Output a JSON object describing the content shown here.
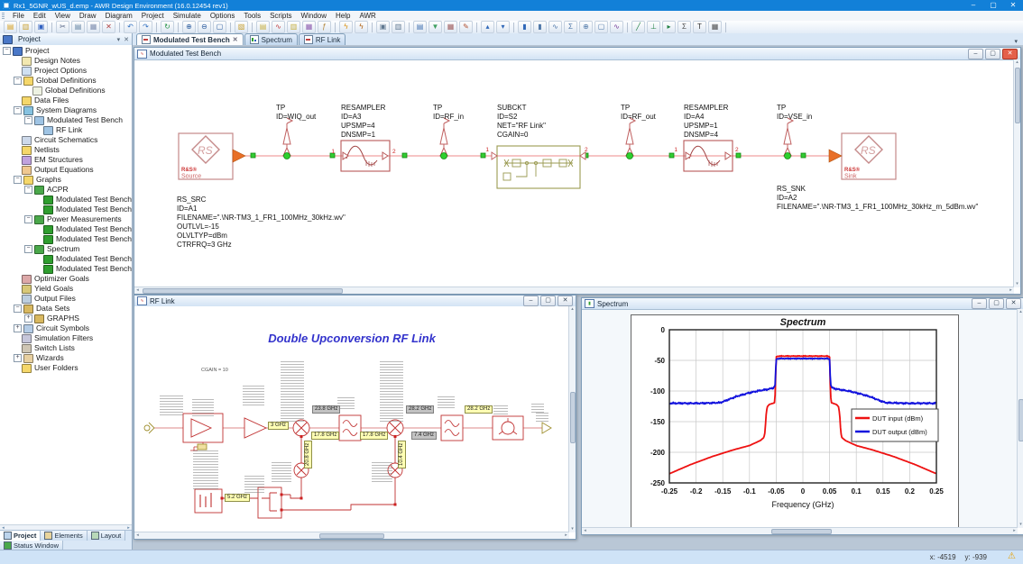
{
  "window": {
    "title": "Rx1_5GNR_wUS_d.emp - AWR Design Environment (16.0.12454 rev1)",
    "controls": {
      "minimize": "–",
      "maximize": "▢",
      "close": "✕"
    }
  },
  "menu": {
    "items": [
      "File",
      "Edit",
      "View",
      "Draw",
      "Diagram",
      "Project",
      "Simulate",
      "Options",
      "Tools",
      "Scripts",
      "Window",
      "Help",
      "AWR"
    ]
  },
  "toolbar": {
    "icons": [
      "new",
      "open",
      "save",
      "sep",
      "cut",
      "copy",
      "paste",
      "delete",
      "sep",
      "undo",
      "redo",
      "sep",
      "refresh",
      "sep",
      "zoom-in",
      "zoom-out",
      "zoom-fit",
      "sep",
      "new-folder",
      "sep",
      "add-schematic",
      "add-system-diagram",
      "add-netlist",
      "add-em-structure",
      "add-output-equation",
      "sep",
      "simulate-analyze",
      "tune",
      "sep",
      "options-dialog",
      "window-split",
      "sep",
      "browser-project",
      "browser-elements",
      "browser-layout",
      "annotate",
      "sep",
      "move-up",
      "move-down",
      "sep",
      "meas-acpr",
      "meas-pwr",
      "meas-spec",
      "meas-sub",
      "meas-mix",
      "meas-q",
      "meas-phase",
      "sep",
      "wire-tool",
      "ground-tool",
      "port-tool",
      "equation-tool",
      "text-tool",
      "block-tool",
      "sep"
    ]
  },
  "project_panel": {
    "title": "Project",
    "tree": [
      {
        "label": "Project",
        "indent": 0,
        "icon": "project",
        "expand": "minus"
      },
      {
        "label": "Design Notes",
        "indent": 1,
        "icon": "notes"
      },
      {
        "label": "Project Options",
        "indent": 1,
        "icon": "options"
      },
      {
        "label": "Global Definitions",
        "indent": 1,
        "icon": "folder",
        "expand": "minus"
      },
      {
        "label": "Global Definitions",
        "indent": 2,
        "icon": "doc"
      },
      {
        "label": "Data Files",
        "indent": 1,
        "icon": "folder"
      },
      {
        "label": "System Diagrams",
        "indent": 1,
        "icon": "system",
        "expand": "minus"
      },
      {
        "label": "Modulated Test Bench",
        "indent": 2,
        "icon": "diagram",
        "expand": "minus"
      },
      {
        "label": "RF Link",
        "indent": 3,
        "icon": "diagram"
      },
      {
        "label": "Circuit Schematics",
        "indent": 1,
        "icon": "schematic"
      },
      {
        "label": "Netlists",
        "indent": 1,
        "icon": "folder"
      },
      {
        "label": "EM Structures",
        "indent": 1,
        "icon": "em"
      },
      {
        "label": "Output Equations",
        "indent": 1,
        "icon": "equations"
      },
      {
        "label": "Graphs",
        "indent": 1,
        "icon": "folder",
        "expand": "minus"
      },
      {
        "label": "ACPR",
        "indent": 2,
        "icon": "graph",
        "expand": "minus"
      },
      {
        "label": "Modulated Test Bench.DB(ACPR(TP.RF_",
        "indent": 3,
        "icon": "meas"
      },
      {
        "label": "Modulated Test Bench.DB(ACPR(TP.RF_",
        "indent": 3,
        "icon": "meas"
      },
      {
        "label": "Power Measurements",
        "indent": 2,
        "icon": "graph",
        "expand": "minus"
      },
      {
        "label": "Modulated Test Bench.DB(PWR_MTR(T",
        "indent": 3,
        "icon": "meas"
      },
      {
        "label": "Modulated Test Bench.DB(PWR_MTR(T",
        "indent": 3,
        "icon": "meas"
      },
      {
        "label": "Spectrum",
        "indent": 2,
        "icon": "graph2",
        "expand": "minus"
      },
      {
        "label": "Modulated Test Bench.DB(PWR_SPEC(T",
        "indent": 3,
        "icon": "meas"
      },
      {
        "label": "Modulated Test Bench.DB(PWR_SPEC(T",
        "indent": 3,
        "icon": "meas"
      },
      {
        "label": "Optimizer Goals",
        "indent": 1,
        "icon": "optimizer"
      },
      {
        "label": "Yield Goals",
        "indent": 1,
        "icon": "yield"
      },
      {
        "label": "Output Files",
        "indent": 1,
        "icon": "output"
      },
      {
        "label": "Data Sets",
        "indent": 1,
        "icon": "datasets",
        "expand": "minus"
      },
      {
        "label": "GRAPHS",
        "indent": 2,
        "icon": "datasets",
        "expand": "plus"
      },
      {
        "label": "Circuit Symbols",
        "indent": 1,
        "icon": "symbols",
        "expand": "plus"
      },
      {
        "label": "Simulation Filters",
        "indent": 1,
        "icon": "filters"
      },
      {
        "label": "Switch Lists",
        "indent": 1,
        "icon": "switch"
      },
      {
        "label": "Wizards",
        "indent": 1,
        "icon": "wizards",
        "expand": "plus"
      },
      {
        "label": "User Folders",
        "indent": 1,
        "icon": "folder"
      }
    ],
    "bottom_tabs": [
      "Project",
      "Elements",
      "Layout"
    ],
    "status_tab": "Status Window"
  },
  "doc_tabs": {
    "tabs": [
      {
        "label": "Modulated Test Bench",
        "active": true
      },
      {
        "label": "Spectrum",
        "active": false
      },
      {
        "label": "RF Link",
        "active": false
      }
    ]
  },
  "mtb": {
    "window_title": "Modulated Test Bench",
    "logo": "RS",
    "source_brand": "R&S®",
    "source_label": "Source",
    "sink_brand": "R&S®",
    "sink_label": "Sink",
    "port1": "1",
    "port2": "2",
    "tp_labels": [
      [
        "TP",
        "ID=WIQ_out"
      ],
      [
        "TP",
        "ID=RF_in"
      ],
      [
        "TP",
        "ID=RF_out"
      ],
      [
        "TP",
        "ID=VSE_in"
      ]
    ],
    "resampler1": [
      "RESAMPLER",
      "ID=A3",
      "UPSMP=4",
      "DNSMP=1"
    ],
    "subckt": [
      "SUBCKT",
      "ID=S2",
      "NET=\"RF Link\"",
      "CGAIN=0"
    ],
    "resampler2": [
      "RESAMPLER",
      "ID=A4",
      "UPSMP=1",
      "DNSMP=4"
    ],
    "source_params": [
      "RS_SRC",
      "ID=A1",
      "FILENAME=\".\\NR-TM3_1_FR1_100MHz_30kHz.wv\"",
      "OUTLVL=-15",
      "OLVLTYP=dBm",
      "CTRFRQ=3 GHz"
    ],
    "sink_params": [
      "RS_SNK",
      "ID=A2",
      "FILENAME=\".\\NR-TM3_1_FR1_100MHz_30kHz_m_5dBm.wv\""
    ]
  },
  "rflink": {
    "window_title": "RF Link",
    "heading": "Double Upconversion RF Link",
    "annotation": "CGAIN = 10",
    "freq_labels": [
      {
        "text": "3 GHz",
        "variant": "yellow"
      },
      {
        "text": "23.8 GHz",
        "variant": "gray"
      },
      {
        "text": "17.8 GHz",
        "variant": "yellow"
      },
      {
        "text": "17.8 GHz",
        "variant": "yellow"
      },
      {
        "text": "28.2 GHz",
        "variant": "gray"
      },
      {
        "text": "7.4 GHz",
        "variant": "gray"
      },
      {
        "text": "28.2 GHz",
        "variant": "yellow"
      },
      {
        "text": "20.8 GHz",
        "variant": "yellow"
      },
      {
        "text": "10.4 GHz",
        "variant": "yellow"
      },
      {
        "text": "5.2 GHz",
        "variant": "yellow"
      }
    ]
  },
  "spectrum": {
    "window_title": "Spectrum"
  },
  "chart_data": {
    "type": "line",
    "title": "Spectrum",
    "xlabel": "Frequency (GHz)",
    "ylabel": "",
    "xlim": [
      -0.25,
      0.25
    ],
    "ylim": [
      -250,
      0
    ],
    "xticks": [
      -0.25,
      -0.2,
      -0.15,
      -0.1,
      -0.05,
      0,
      0.05,
      0.1,
      0.15,
      0.2,
      0.25
    ],
    "yticks": [
      0,
      -50,
      -100,
      -150,
      -200,
      -250
    ],
    "grid": true,
    "legend_position": "right-center",
    "series": [
      {
        "name": "DUT input (dBm)",
        "color": "#ee1111",
        "noise_top": 0.9,
        "noise_rest": 0.15,
        "keypoints": [
          [
            -0.25,
            -235
          ],
          [
            -0.21,
            -220
          ],
          [
            -0.17,
            -207
          ],
          [
            -0.13,
            -196
          ],
          [
            -0.1,
            -189
          ],
          [
            -0.08,
            -181
          ],
          [
            -0.073,
            -176
          ],
          [
            -0.071,
            -168
          ],
          [
            -0.069,
            -140
          ],
          [
            -0.067,
            -126
          ],
          [
            -0.063,
            -122
          ],
          [
            -0.056,
            -120
          ],
          [
            -0.053,
            -119
          ],
          [
            -0.0515,
            -100
          ],
          [
            -0.0505,
            -60
          ],
          [
            -0.05,
            -44
          ],
          [
            -0.045,
            -43
          ],
          [
            0.045,
            -43
          ],
          [
            0.05,
            -44
          ],
          [
            0.0505,
            -60
          ],
          [
            0.0515,
            -100
          ],
          [
            0.053,
            -119
          ],
          [
            0.056,
            -120
          ],
          [
            0.063,
            -122
          ],
          [
            0.067,
            -126
          ],
          [
            0.069,
            -140
          ],
          [
            0.071,
            -168
          ],
          [
            0.073,
            -176
          ],
          [
            0.08,
            -181
          ],
          [
            0.1,
            -189
          ],
          [
            0.13,
            -196
          ],
          [
            0.17,
            -207
          ],
          [
            0.21,
            -220
          ],
          [
            0.25,
            -235
          ]
        ]
      },
      {
        "name": "DUT output (dBm)",
        "color": "#1111dd",
        "noise_top": 1.0,
        "noise_rest": 1.7,
        "keypoints": [
          [
            -0.25,
            -120
          ],
          [
            -0.19,
            -120
          ],
          [
            -0.155,
            -119
          ],
          [
            -0.145,
            -116
          ],
          [
            -0.125,
            -109
          ],
          [
            -0.105,
            -104
          ],
          [
            -0.085,
            -100
          ],
          [
            -0.065,
            -97
          ],
          [
            -0.055,
            -95
          ],
          [
            -0.052,
            -90
          ],
          [
            -0.051,
            -70
          ],
          [
            -0.05,
            -48
          ],
          [
            -0.045,
            -47
          ],
          [
            0.045,
            -47
          ],
          [
            0.05,
            -48
          ],
          [
            0.051,
            -70
          ],
          [
            0.052,
            -90
          ],
          [
            0.055,
            -95
          ],
          [
            0.065,
            -97
          ],
          [
            0.085,
            -100
          ],
          [
            0.105,
            -104
          ],
          [
            0.125,
            -109
          ],
          [
            0.145,
            -116
          ],
          [
            0.155,
            -119
          ],
          [
            0.19,
            -120
          ],
          [
            0.25,
            -120
          ]
        ]
      }
    ]
  },
  "status_bar": {
    "x": "x: -4519",
    "y": "y: -939"
  }
}
